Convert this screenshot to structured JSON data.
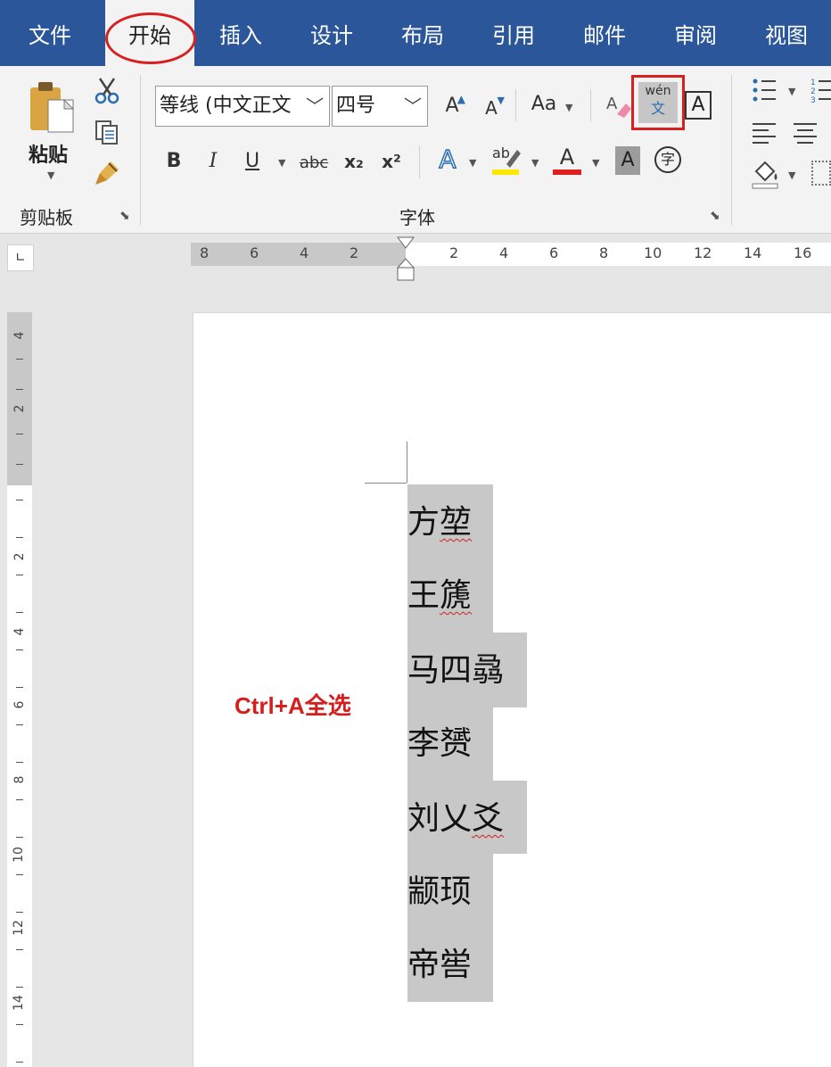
{
  "tabs": [
    "文件",
    "开始",
    "插入",
    "设计",
    "布局",
    "引用",
    "邮件",
    "审阅",
    "视图"
  ],
  "ribbon": {
    "clipboard": {
      "paste": "粘贴",
      "group_label": "剪贴板"
    },
    "font": {
      "font_name": "等线 (中文正文",
      "font_size": "四号",
      "grow": "A",
      "shrink": "A",
      "case": "Aa",
      "bold": "B",
      "italic": "I",
      "underline": "U",
      "strike": "abc",
      "subscript": "x₂",
      "superscript": "x²",
      "phonetic_top": "wén",
      "phonetic_bottom": "文",
      "char_border": "A",
      "effects": "A",
      "highlight": "ab",
      "font_color": "A",
      "shading": "A",
      "enclose": "字",
      "group_label": "字体"
    }
  },
  "ruler": {
    "h": [
      "8",
      "6",
      "4",
      "2",
      "2",
      "4",
      "6",
      "8",
      "10",
      "12",
      "14",
      "16"
    ],
    "v": [
      "4",
      "2",
      "2",
      "4",
      "6",
      "8",
      "10",
      "12",
      "14"
    ]
  },
  "document": {
    "caption": "Ctrl+A全选",
    "lines": [
      {
        "head": "方",
        "tail": "堃",
        "wavy": true
      },
      {
        "head": "王",
        "tail": "篪",
        "wavy": true
      },
      {
        "head": "马四",
        "tail": "骉",
        "wavy": false
      },
      {
        "head": "李",
        "tail": "赟",
        "wavy": false
      },
      {
        "head": "刘乂",
        "tail": "爻",
        "wavy": true
      },
      {
        "head": "颛",
        "tail": "顼",
        "wavy": false
      },
      {
        "head": "帝",
        "tail": "喾",
        "wavy": false
      }
    ]
  },
  "colors": {
    "tabbar": "#2b579a",
    "highlight_red": "#d72020",
    "selection": "#c8c8c8"
  }
}
